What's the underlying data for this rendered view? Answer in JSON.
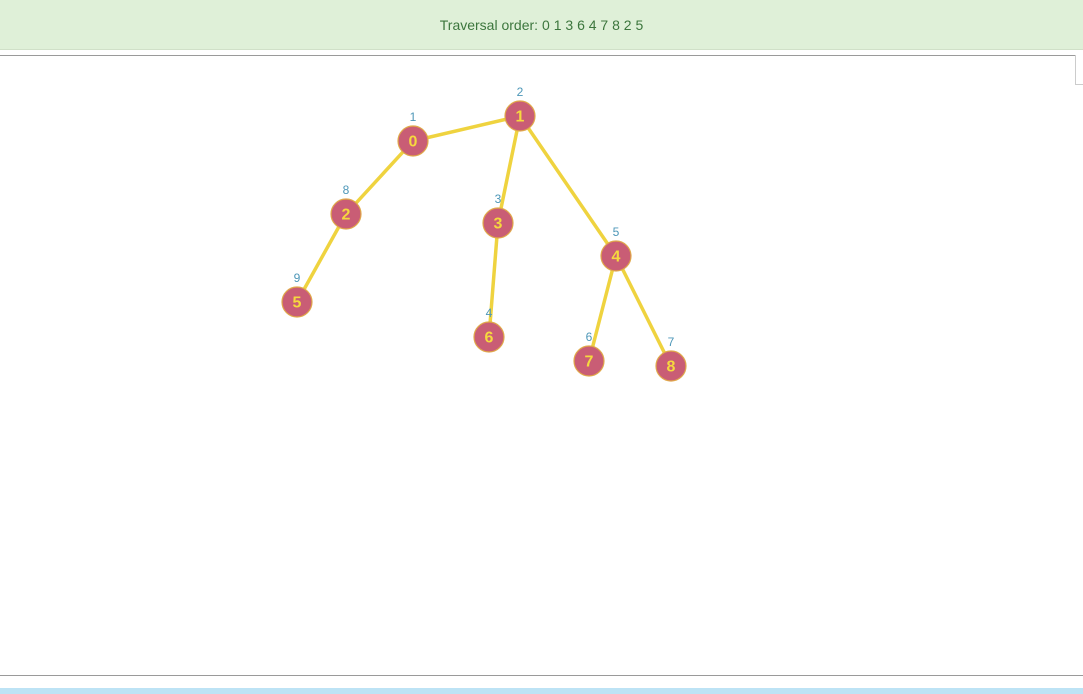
{
  "banner": {
    "label": "Traversal order:",
    "order": "0 1 3 6 4 7 8 2 5"
  },
  "colors": {
    "node_fill": "#c95d75",
    "node_text": "#f5d93e",
    "edge": "#efd33f",
    "order_label": "#4d97b8",
    "banner_bg": "#dff0d8",
    "banner_text": "#3c763d"
  },
  "graph": {
    "nodes": [
      {
        "id": "0",
        "order": "1"
      },
      {
        "id": "1",
        "order": "2"
      },
      {
        "id": "2",
        "order": "8"
      },
      {
        "id": "3",
        "order": "3"
      },
      {
        "id": "4",
        "order": "5"
      },
      {
        "id": "5",
        "order": "9"
      },
      {
        "id": "6",
        "order": "4"
      },
      {
        "id": "7",
        "order": "6"
      },
      {
        "id": "8",
        "order": "7"
      }
    ],
    "edges": [
      [
        "0",
        "1"
      ],
      [
        "0",
        "2"
      ],
      [
        "2",
        "5"
      ],
      [
        "1",
        "3"
      ],
      [
        "3",
        "6"
      ],
      [
        "1",
        "4"
      ],
      [
        "4",
        "7"
      ],
      [
        "4",
        "8"
      ]
    ]
  }
}
